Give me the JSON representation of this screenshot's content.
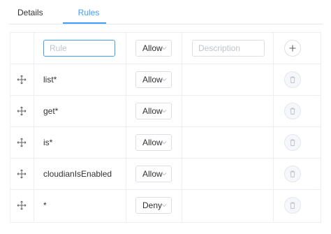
{
  "tabs": [
    {
      "label": "Details",
      "active": false
    },
    {
      "label": "Rules",
      "active": true
    }
  ],
  "new_rule": {
    "rule_placeholder": "Rule",
    "effect": "Allow",
    "description_placeholder": "Description",
    "add_icon": "plus-icon"
  },
  "rules": [
    {
      "name": "list*",
      "effect": "Allow",
      "description": ""
    },
    {
      "name": "get*",
      "effect": "Allow",
      "description": ""
    },
    {
      "name": "is*",
      "effect": "Allow",
      "description": ""
    },
    {
      "name": "cloudianIsEnabled",
      "effect": "Allow",
      "description": ""
    },
    {
      "name": "*",
      "effect": "Deny",
      "description": ""
    }
  ],
  "icons": {
    "drag": "drag-move-icon",
    "delete": "trash-icon",
    "chevron": "chevron-down-icon"
  },
  "colors": {
    "accent": "#409eff",
    "border": "#dcdfe6",
    "grid_line": "#ebeef5",
    "placeholder": "#c0c4cc"
  }
}
